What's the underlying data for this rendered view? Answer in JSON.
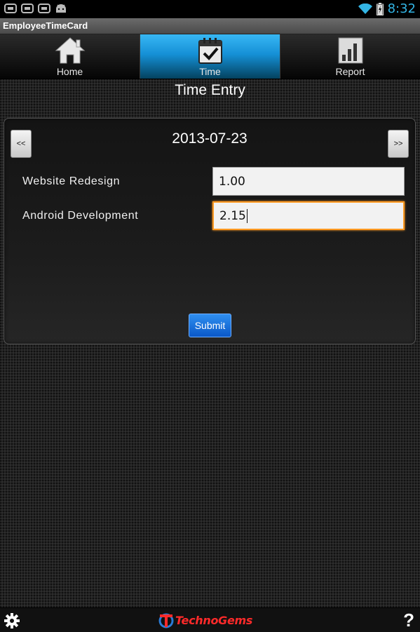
{
  "status_bar": {
    "time": "8:32"
  },
  "app": {
    "title": "EmployeeTimeCard"
  },
  "tabs": [
    {
      "label": "Home",
      "icon": "home-icon",
      "active": false
    },
    {
      "label": "Time",
      "icon": "calendar-check-icon",
      "active": true
    },
    {
      "label": "Report",
      "icon": "bar-chart-icon",
      "active": false
    }
  ],
  "page": {
    "title": "Time Entry"
  },
  "entry": {
    "prev_label": "<<",
    "next_label": ">>",
    "date": "2013-07-23",
    "rows": [
      {
        "label": "Website Redesign",
        "value": "1.00"
      },
      {
        "label": "Android Development",
        "value": "2.15"
      }
    ],
    "submit_label": "Submit"
  },
  "footer": {
    "brand": "TechnoGems",
    "help": "?"
  },
  "colors": {
    "accent": "#33b5e5",
    "focus": "#ff9a22",
    "brand": "#ff2a2a",
    "submit": "#1a6fe0"
  }
}
